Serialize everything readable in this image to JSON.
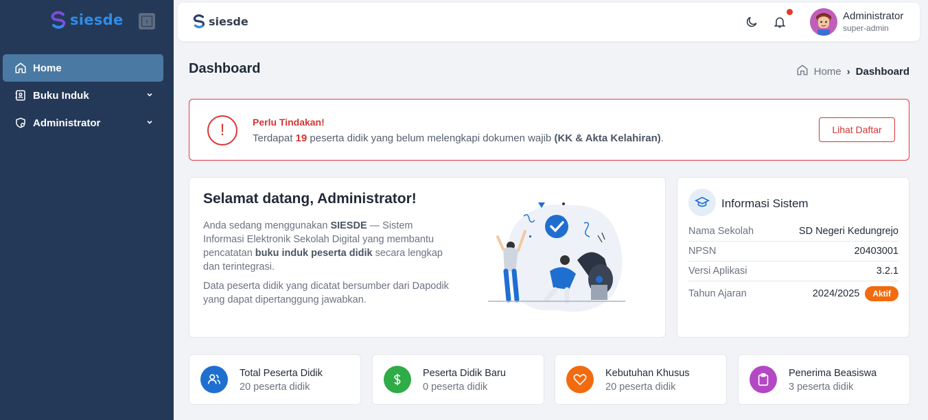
{
  "brand": {
    "name": "siesde"
  },
  "sidebar": {
    "items": [
      {
        "label": "Home",
        "icon": "home-icon",
        "active": true
      },
      {
        "label": "Buku Induk",
        "icon": "book-icon",
        "active": false
      },
      {
        "label": "Administrator",
        "icon": "user-gear-icon",
        "active": false
      }
    ]
  },
  "topbar": {
    "user_name": "Administrator",
    "user_role": "super-admin"
  },
  "header": {
    "title": "Dashboard",
    "breadcrumb_home": "Home",
    "breadcrumb_current": "Dashboard"
  },
  "alert": {
    "title": "Perlu Tindakan!",
    "text_before": "Terdapat ",
    "count": "19",
    "text_middle": " peserta didik yang belum melengkapi dokumen wajib ",
    "documents": "(KK & Akta Kelahiran)",
    "text_after": ".",
    "button": "Lihat Daftar"
  },
  "welcome": {
    "title": "Selamat datang, Administrator!",
    "p1_a": "Anda sedang menggunakan ",
    "p1_b": "SIESDE",
    "p1_c": " — Sistem Informasi Elektronik Sekolah Digital yang membantu pencatatan ",
    "p1_d": "buku induk peserta didik",
    "p1_e": " secara lengkap dan terintegrasi.",
    "p2": "Data peserta didik yang dicatat bersumber dari Dapodik yang dapat dipertanggung jawabkan."
  },
  "info": {
    "title": "Informasi Sistem",
    "rows": [
      {
        "key": "Nama Sekolah",
        "value": "SD Negeri Kedungrejo"
      },
      {
        "key": "NPSN",
        "value": "20403001"
      },
      {
        "key": "Versi Aplikasi",
        "value": "3.2.1"
      },
      {
        "key": "Tahun Ajaran",
        "value": "2024/2025"
      }
    ],
    "status_badge": "Aktif"
  },
  "stats": [
    {
      "label": "Total Peserta Didik",
      "value": "20 peserta didik",
      "icon": "users-icon",
      "color": "#1f6fd0"
    },
    {
      "label": "Peserta Didik Baru",
      "value": "0 peserta didik",
      "icon": "dollar-icon",
      "color": "#2fab48"
    },
    {
      "label": "Kebutuhan Khusus",
      "value": "20 peserta didik",
      "icon": "heart-icon",
      "color": "#f26b0f"
    },
    {
      "label": "Penerima Beasiswa",
      "value": "3 peserta didik",
      "icon": "clipboard-icon",
      "color": "#b347c4"
    }
  ]
}
